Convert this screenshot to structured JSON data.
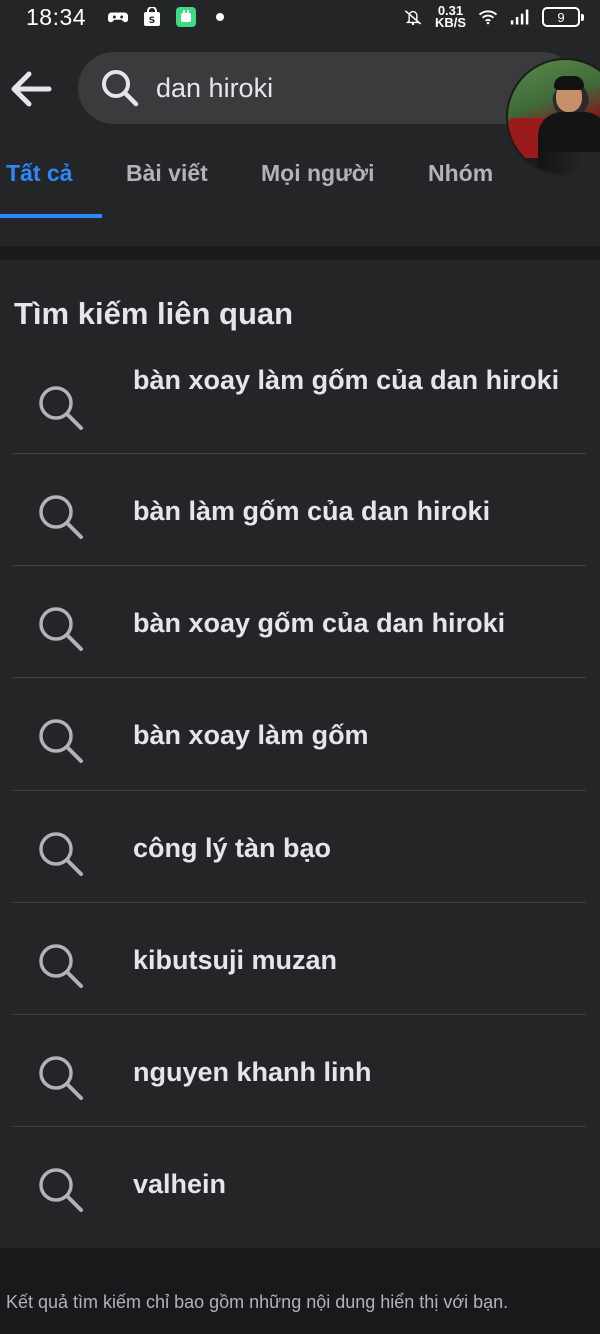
{
  "status_bar": {
    "time": "18:34",
    "net_speed_value": "0.31",
    "net_speed_unit": "KB/S",
    "battery": "9"
  },
  "search": {
    "value": "dan hiroki"
  },
  "tabs": [
    {
      "label": "Tất cả",
      "active": true
    },
    {
      "label": "Bài viết",
      "active": false
    },
    {
      "label": "Mọi người",
      "active": false
    },
    {
      "label": "Nhóm",
      "active": false
    }
  ],
  "related": {
    "title": "Tìm kiếm liên quan",
    "items": [
      {
        "text": "bàn xoay làm gốm của dan hiroki"
      },
      {
        "text": "bàn làm gốm của dan hiroki"
      },
      {
        "text": "bàn xoay gốm của dan hiroki"
      },
      {
        "text": "bàn xoay làm gốm"
      },
      {
        "text": "công lý tàn bạo"
      },
      {
        "text": "kibutsuji muzan"
      },
      {
        "text": "nguyen khanh linh"
      },
      {
        "text": "valhein"
      }
    ]
  },
  "footer": {
    "note": "Kết quả tìm kiếm chỉ bao gồm những nội dung hiển thị với bạn."
  },
  "colors": {
    "accent": "#2d88ff",
    "surface": "#242526",
    "background": "#18191a"
  }
}
